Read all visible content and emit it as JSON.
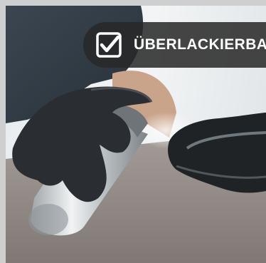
{
  "image": {
    "description_icon": "checkbox-check-icon",
    "badge": {
      "label": "ÜBERLACKIERBA",
      "icon": "checkbox-check-icon",
      "background_color": "#2b2b2b",
      "text_color": "#ffffff"
    }
  }
}
